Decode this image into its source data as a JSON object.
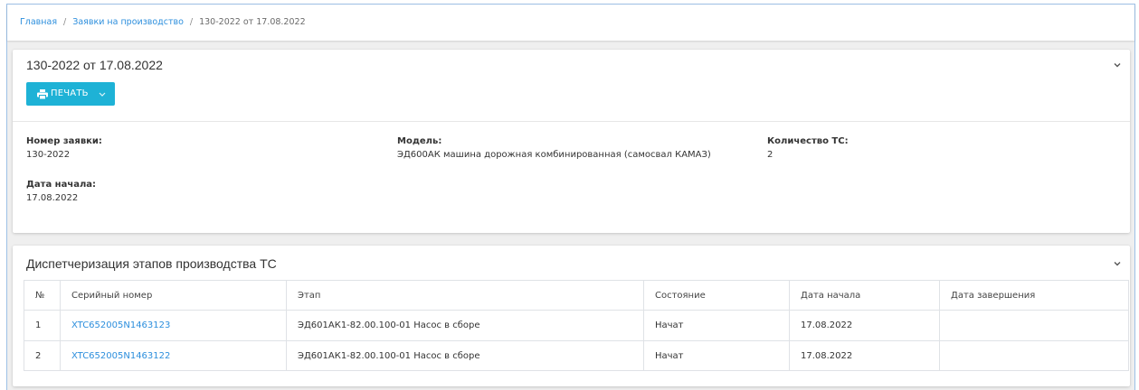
{
  "breadcrumb": {
    "items": [
      {
        "label": "Главная"
      },
      {
        "label": "Заявки на производство"
      }
    ],
    "separator": "/",
    "current": "130-2022 от 17.08.2022"
  },
  "order_card": {
    "title": "130-2022 от 17.08.2022",
    "collapse_icon": "chevron-down-icon",
    "print_button": {
      "label": "ПЕЧАТЬ",
      "icon": "printer-icon",
      "dropdown_icon": "chevron-down-icon"
    },
    "fields": {
      "order_number": {
        "label": "Номер заявки:",
        "value": "130-2022"
      },
      "model": {
        "label": "Модель:",
        "value": "ЭД600АК машина дорожная комбинированная (самосвал КАМАЗ)"
      },
      "vehicle_count": {
        "label": "Количество ТС:",
        "value": "2"
      },
      "start_date": {
        "label": "Дата начала:",
        "value": "17.08.2022"
      }
    }
  },
  "dispatch_card": {
    "title": "Диспетчеризация этапов производства ТС",
    "collapse_icon": "chevron-down-icon",
    "table": {
      "columns": [
        "№",
        "Серийный номер",
        "Этап",
        "Состояние",
        "Дата начала",
        "Дата завершения"
      ],
      "rows": [
        {
          "num": "1",
          "serial": "XTC652005N1463123",
          "stage": "ЭД601АК1-82.00.100-01 Насос в сборе",
          "status": "Начат",
          "start_date": "17.08.2022",
          "end_date": ""
        },
        {
          "num": "2",
          "serial": "XTC652005N1463122",
          "stage": "ЭД601АК1-82.00.100-01 Насос в сборе",
          "status": "Начат",
          "start_date": "17.08.2022",
          "end_date": ""
        }
      ]
    }
  },
  "colors": {
    "accent": "#1eb2d6",
    "link": "#2d8fdd",
    "frame_border": "#9dc0e6",
    "page_background": "#efefef"
  }
}
